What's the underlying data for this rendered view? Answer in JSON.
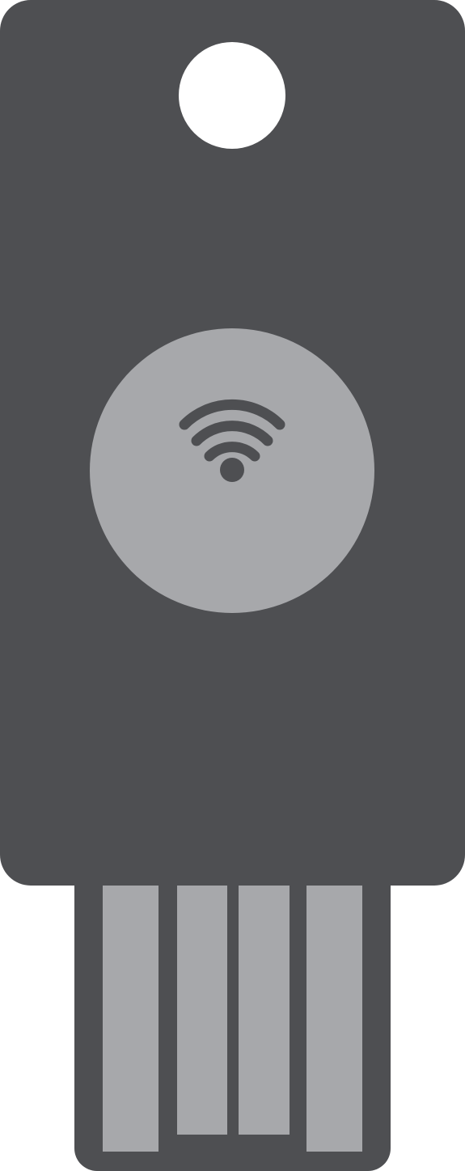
{
  "device": {
    "icon": "security-key-nfc",
    "colors": {
      "body": "#4e4f52",
      "detail": "#a7a8ab",
      "background": "#ffffff"
    },
    "touch_sensor_icon": "nfc-wireless-icon",
    "hole_icon": "keyring-hole",
    "usb_contacts_count": 4
  }
}
